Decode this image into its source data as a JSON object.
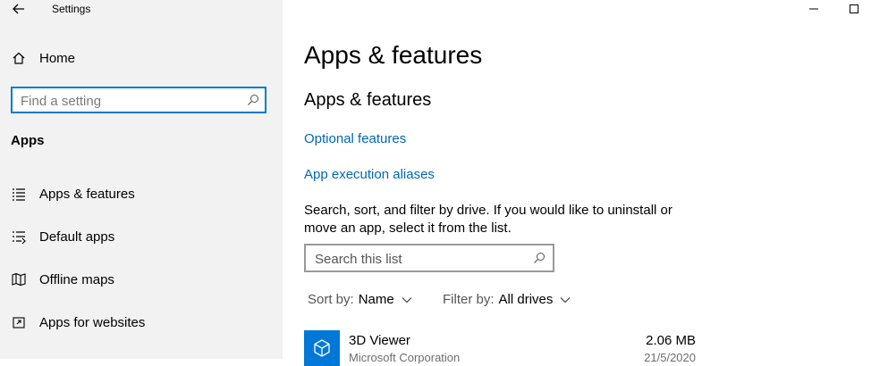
{
  "window": {
    "title": "Settings"
  },
  "sidebar": {
    "home_label": "Home",
    "search_placeholder": "Find a setting",
    "section_label": "Apps",
    "items": [
      {
        "label": "Apps & features",
        "icon": "list-icon"
      },
      {
        "label": "Default apps",
        "icon": "default-apps-icon"
      },
      {
        "label": "Offline maps",
        "icon": "map-icon"
      },
      {
        "label": "Apps for websites",
        "icon": "open-in-icon"
      }
    ]
  },
  "main": {
    "page_title": "Apps & features",
    "section_title": "Apps & features",
    "links": {
      "optional_features": "Optional features",
      "app_execution_aliases": "App execution aliases"
    },
    "description": "Search, sort, and filter by drive. If you would like to uninstall or move an app, select it from the list.",
    "list_search_placeholder": "Search this list",
    "sort": {
      "key": "Sort by:",
      "value": "Name"
    },
    "filter": {
      "key": "Filter by:",
      "value": "All drives"
    },
    "apps": [
      {
        "name": "3D Viewer",
        "publisher": "Microsoft Corporation",
        "size": "2.06 MB",
        "date": "21/5/2020"
      }
    ]
  },
  "colors": {
    "accent": "#0078d7",
    "link": "#0067b8",
    "sidebar_bg": "#f2f2f2"
  }
}
